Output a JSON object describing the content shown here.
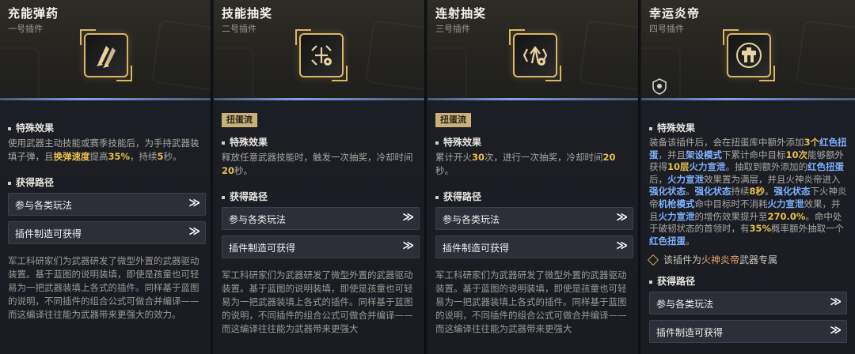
{
  "panels": [
    {
      "title": "充能弹药",
      "subtitle": "一号插件",
      "icon": "rockets-icon",
      "effect_head": "特殊效果",
      "effect": [
        {
          "t": "使用武器主动技能或赛季技能后，为手持武器装填子弹，且"
        },
        {
          "t": "换弹速度",
          "c": "hl"
        },
        {
          "t": "提高"
        },
        {
          "t": "35%",
          "c": "hl"
        },
        {
          "t": "，持续"
        },
        {
          "t": "5",
          "c": "hl"
        },
        {
          "t": "秒。"
        }
      ],
      "route_head": "获得路径",
      "routes": [
        "参与各类玩法",
        "插件制造可获得"
      ],
      "chevron": "≫",
      "lore": "军工科研家们为武器研发了微型外置的武器驱动装置。基于蓝图的说明装填，即使是孩童也可轻易为一把武器装填上各式的插件。同样基于蓝图的说明，不同插件的组合公式可做合并编译——而这编译往往能为武器带来更强大的效力。"
    },
    {
      "title": "技能抽奖",
      "subtitle": "二号插件",
      "icon": "lottery-spin-icon",
      "tag": "扭蛋流",
      "effect_head": "特殊效果",
      "effect": [
        {
          "t": "释放任意武器技能时，触发一次抽奖，冷却时间"
        },
        {
          "t": "20",
          "c": "hl"
        },
        {
          "t": "秒。"
        }
      ],
      "route_head": "获得路径",
      "routes": [
        "参与各类玩法",
        "插件制造可获得"
      ],
      "chevron": "≫",
      "lore": "军工科研家们为武器研发了微型外置的武器驱动装置。基于蓝图的说明装填，即使是孩童也可轻易为一把武器装填上各式的插件。同样基于蓝图的说明，不同插件的组合公式可做合并编译——而这编译往往能为武器带来更强大"
    },
    {
      "title": "连射抽奖",
      "subtitle": "三号插件",
      "icon": "burst-lottery-icon",
      "tag": "扭蛋流",
      "effect_head": "特殊效果",
      "effect": [
        {
          "t": "累计开火"
        },
        {
          "t": "30",
          "c": "hl"
        },
        {
          "t": "次，进行一次抽奖，冷却时间"
        },
        {
          "t": "20",
          "c": "hl"
        },
        {
          "t": "秒。"
        }
      ],
      "route_head": "获得路径",
      "routes": [
        "参与各类玩法",
        "插件制造可获得"
      ],
      "chevron": "≫",
      "lore": "军工科研家们为武器研发了微型外置的武器驱动装置。基于蓝图的说明装填，即使是孩童也可轻易为一把武器装填上各式的插件。同样基于蓝图的说明，不同插件的组合公式可做合并编译——而这编译往往能为武器带来更强大"
    },
    {
      "title": "幸运炎帝",
      "subtitle": "四号插件",
      "icon": "fire-emperor-icon",
      "effect_head": "特殊效果",
      "effect": [
        {
          "t": "装备该插件后，会在扭蛋库中额外添加"
        },
        {
          "t": "3个",
          "c": "hl"
        },
        {
          "t": "红色扭蛋",
          "c": "blue"
        },
        {
          "t": "，并且"
        },
        {
          "t": "架设模式",
          "c": "blue"
        },
        {
          "t": "下累计命中目标"
        },
        {
          "t": "10次",
          "c": "hl"
        },
        {
          "t": "能够额外获得"
        },
        {
          "t": "10层",
          "c": "hl"
        },
        {
          "t": "火力宣泄",
          "c": "blue"
        },
        {
          "t": "。抽取到额外添加的"
        },
        {
          "t": "红色扭蛋",
          "c": "blue"
        },
        {
          "t": "后，"
        },
        {
          "t": "火力宣泄",
          "c": "blue"
        },
        {
          "t": "效果置为满层，并且火神炎帝进入"
        },
        {
          "t": "强化状态",
          "c": "blue"
        },
        {
          "t": "。"
        },
        {
          "t": "强化状态",
          "c": "blue"
        },
        {
          "t": "持续"
        },
        {
          "t": "8秒",
          "c": "hl"
        },
        {
          "t": "。"
        },
        {
          "t": "强化状态",
          "c": "blue"
        },
        {
          "t": "下火神炎帝"
        },
        {
          "t": "机枪模式",
          "c": "blue"
        },
        {
          "t": "命中目标时不消耗"
        },
        {
          "t": "火力宣泄",
          "c": "blue"
        },
        {
          "t": "效果，并且"
        },
        {
          "t": "火力宣泄",
          "c": "blue"
        },
        {
          "t": "的增伤效果提升至"
        },
        {
          "t": "270.0%",
          "c": "hl"
        },
        {
          "t": "。命中处于破韧状态的首领时，有"
        },
        {
          "t": "35%",
          "c": "hl"
        },
        {
          "t": "概率额外抽取一个"
        },
        {
          "t": "红色扭蛋",
          "c": "blue"
        },
        {
          "t": "。"
        }
      ],
      "exclusive_pre": "该插件为",
      "exclusive_name": "火神炎帝",
      "exclusive_post": "武器专属",
      "route_head": "获得路径",
      "routes": [
        "参与各类玩法",
        "插件制造可获得"
      ],
      "chevron": "≫"
    }
  ]
}
